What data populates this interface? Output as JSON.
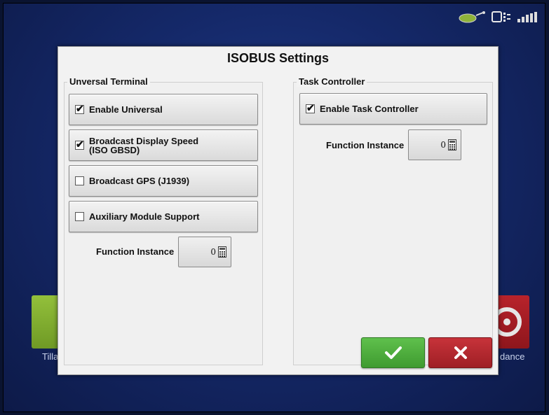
{
  "dialog": {
    "title": "ISOBUS Settings"
  },
  "universal_terminal": {
    "title": "Unversal Terminal",
    "options": [
      {
        "label": "Enable Universal",
        "checked": true
      },
      {
        "label_line1": "Broadcast Display Speed",
        "label_line2": "(ISO GBSD)",
        "checked": true
      },
      {
        "label": "Broadcast GPS (J1939)",
        "checked": false
      },
      {
        "label": "Auxiliary Module Support",
        "checked": false
      }
    ],
    "function_instance_label": "Function Instance",
    "function_instance_value": "0"
  },
  "task_controller": {
    "title": "Task Controller",
    "options": [
      {
        "label": "Enable Task Controller",
        "checked": true
      }
    ],
    "function_instance_label": "Function Instance",
    "function_instance_value": "0"
  },
  "actions": {
    "ok_icon": "checkmark-icon",
    "cancel_icon": "x-icon"
  },
  "background": {
    "tile_left_label": "Tilla",
    "tile_right_label": "dance"
  },
  "status_bar": {
    "icons": [
      "gps-satellite-icon",
      "display-module-icon",
      "cellular-signal-icon"
    ]
  }
}
